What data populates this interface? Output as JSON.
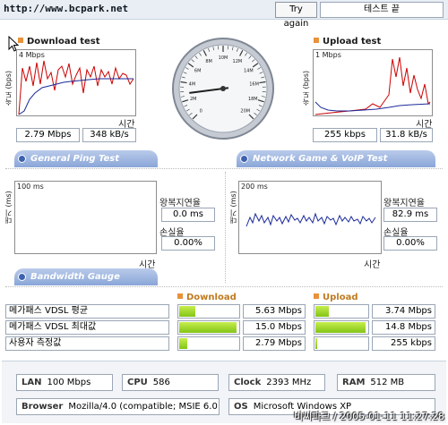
{
  "header": {
    "url": "http://www.bcpark.net",
    "retry_label": "Try again",
    "status_label": "테스트 끝"
  },
  "download": {
    "title": "Download test",
    "y_axis": "속도 (bps)",
    "scale": "4 Mbps",
    "time_label": "시간",
    "mbps": "2.79 Mbps",
    "kbs": "348 kB/s"
  },
  "upload": {
    "title": "Upload test",
    "y_axis": "속도 (bps)",
    "scale": "1 Mbps",
    "time_label": "시간",
    "kbps": "255 kbps",
    "kbs": "31.8 kB/s"
  },
  "gauge": {
    "ticks": [
      "0",
      "2M",
      "4M",
      "6M",
      "8M",
      "10M",
      "12M",
      "14M",
      "16M",
      "18M",
      "20M"
    ],
    "reading_mbps": 2.79
  },
  "sections": {
    "ping_tab": "General Ping Test",
    "game_tab": "Network Game & VoIP Test",
    "bandwidth_tab": "Bandwidth Gauge"
  },
  "ping": {
    "y_axis": "대기 (ms)",
    "scale": "100 ms",
    "time_label": "시간",
    "latency_label": "왕복지연율",
    "latency_value": "0.0 ms",
    "loss_label": "손실율",
    "loss_value": "0.00%"
  },
  "game": {
    "y_axis": "대기 (ms)",
    "scale": "200 ms",
    "time_label": "시간",
    "latency_label": "왕복지연율",
    "latency_value": "82.9 ms",
    "loss_label": "손실율",
    "loss_value": "0.00%"
  },
  "bandwidth": {
    "download_head": "Download",
    "upload_head": "Upload",
    "rows": [
      {
        "label": "메가패스 VDSL 평균",
        "down_value": "5.63 Mbps",
        "down_fill": 0.27,
        "up_value": "3.74 Mbps",
        "up_fill": 0.25
      },
      {
        "label": "메가패스 VDSL 최대값",
        "down_value": "15.0 Mbps",
        "down_fill": 0.97,
        "up_value": "14.8 Mbps",
        "up_fill": 0.97
      },
      {
        "label": "사용자 측정값",
        "down_value": "2.79 Mbps",
        "down_fill": 0.14,
        "up_value": "255 kbps",
        "up_fill": 0.04
      }
    ]
  },
  "system": {
    "lan_key": "LAN",
    "lan": "100 Mbps",
    "cpu_key": "CPU",
    "cpu": "586",
    "clock_key": "Clock",
    "clock": "2393 MHz",
    "ram_key": "RAM",
    "ram": "512 MB",
    "browser_key": "Browser",
    "browser": "Mozilla/4.0 (compatible; MSIE 6.0",
    "os_key": "OS",
    "os": "Microsoft Windows XP"
  },
  "watermark": "비씨파크 / 2005-01-11 11:27:28",
  "colors": {
    "accent": "#e8923a",
    "tab": "#8aa6d8",
    "bar": "#9ed42a",
    "line_red": "#cc0000",
    "line_blue": "#1a2a9a"
  }
}
